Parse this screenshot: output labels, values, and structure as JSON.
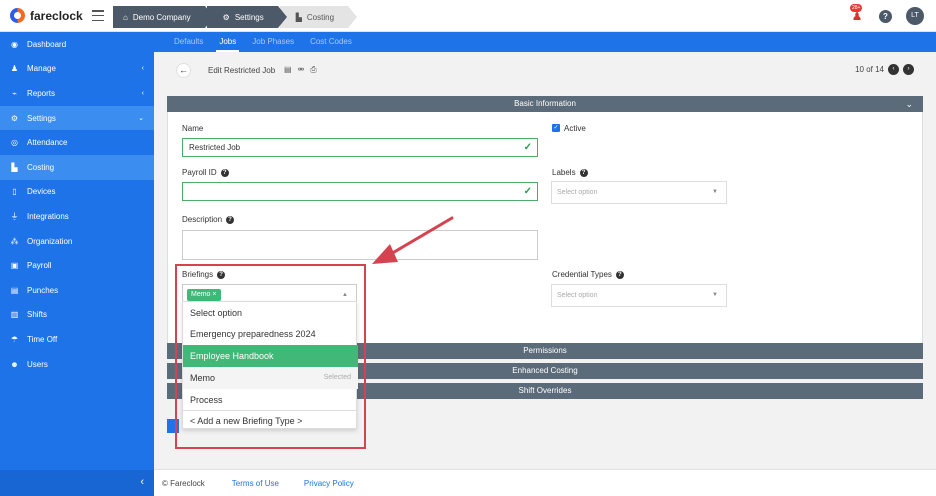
{
  "brand": {
    "name": "fareclock"
  },
  "breadcrumbs": [
    "Demo Company",
    "Settings",
    "Costing"
  ],
  "notifications_count": "28+",
  "help_label": "?",
  "user_initials": "LT",
  "sidebar": {
    "items": [
      {
        "label": "Dashboard",
        "icon": "dashboard-icon",
        "glyph": "◉"
      },
      {
        "label": "Manage",
        "icon": "person-icon",
        "glyph": "♟",
        "chevron": "‹"
      },
      {
        "label": "Reports",
        "icon": "chart-icon",
        "glyph": "⌁",
        "chevron": "‹"
      },
      {
        "label": "Settings",
        "icon": "gear-icon",
        "glyph": "⚙",
        "chevron": "⌄"
      },
      {
        "label": "Attendance",
        "icon": "target-icon",
        "glyph": "◎"
      },
      {
        "label": "Costing",
        "icon": "factory-icon",
        "glyph": "▙"
      },
      {
        "label": "Devices",
        "icon": "tablet-icon",
        "glyph": "▯"
      },
      {
        "label": "Integrations",
        "icon": "plug-icon",
        "glyph": "⏚"
      },
      {
        "label": "Organization",
        "icon": "sitemap-icon",
        "glyph": "⁂"
      },
      {
        "label": "Payroll",
        "icon": "money-icon",
        "glyph": "▣"
      },
      {
        "label": "Punches",
        "icon": "truck-icon",
        "glyph": "▤"
      },
      {
        "label": "Shifts",
        "icon": "clipboard-icon",
        "glyph": "▥"
      },
      {
        "label": "Time Off",
        "icon": "umbrella-icon",
        "glyph": "☂"
      },
      {
        "label": "Users",
        "icon": "users-icon",
        "glyph": "☻"
      }
    ]
  },
  "tabs": [
    "Defaults",
    "Jobs",
    "Job Phases",
    "Cost Codes"
  ],
  "page": {
    "title": "Edit Restricted Job",
    "pager": "10 of 14"
  },
  "sections": {
    "basic": "Basic Information",
    "permissions": "Permissions",
    "enhanced": "Enhanced Costing",
    "overrides": "Shift Overrides"
  },
  "form": {
    "name_label": "Name",
    "name_value": "Restricted Job",
    "active_label": "Active",
    "payroll_label": "Payroll ID",
    "payroll_value": "",
    "labels_label": "Labels",
    "labels_placeholder": "Select option",
    "description_label": "Description",
    "briefings_label": "Briefings",
    "briefings_tag": "Memo",
    "briefings_tag_remove": "×",
    "credential_label": "Credential Types",
    "credential_placeholder": "Select option"
  },
  "dropdown": {
    "options": [
      "Select option",
      "Emergency preparedness 2024",
      "Employee Handbook",
      "Memo",
      "Process"
    ],
    "selected_note": "Selected",
    "add_new": "< Add a new Briefing Type >"
  },
  "footer": {
    "copyright": "© Fareclock",
    "terms": "Terms of Use",
    "privacy": "Privacy Policy"
  },
  "colors": {
    "primary": "#1f73e8",
    "section_bar": "#5c6b7a",
    "highlight_green": "#3fb878",
    "annotation_red": "#d4434f"
  }
}
